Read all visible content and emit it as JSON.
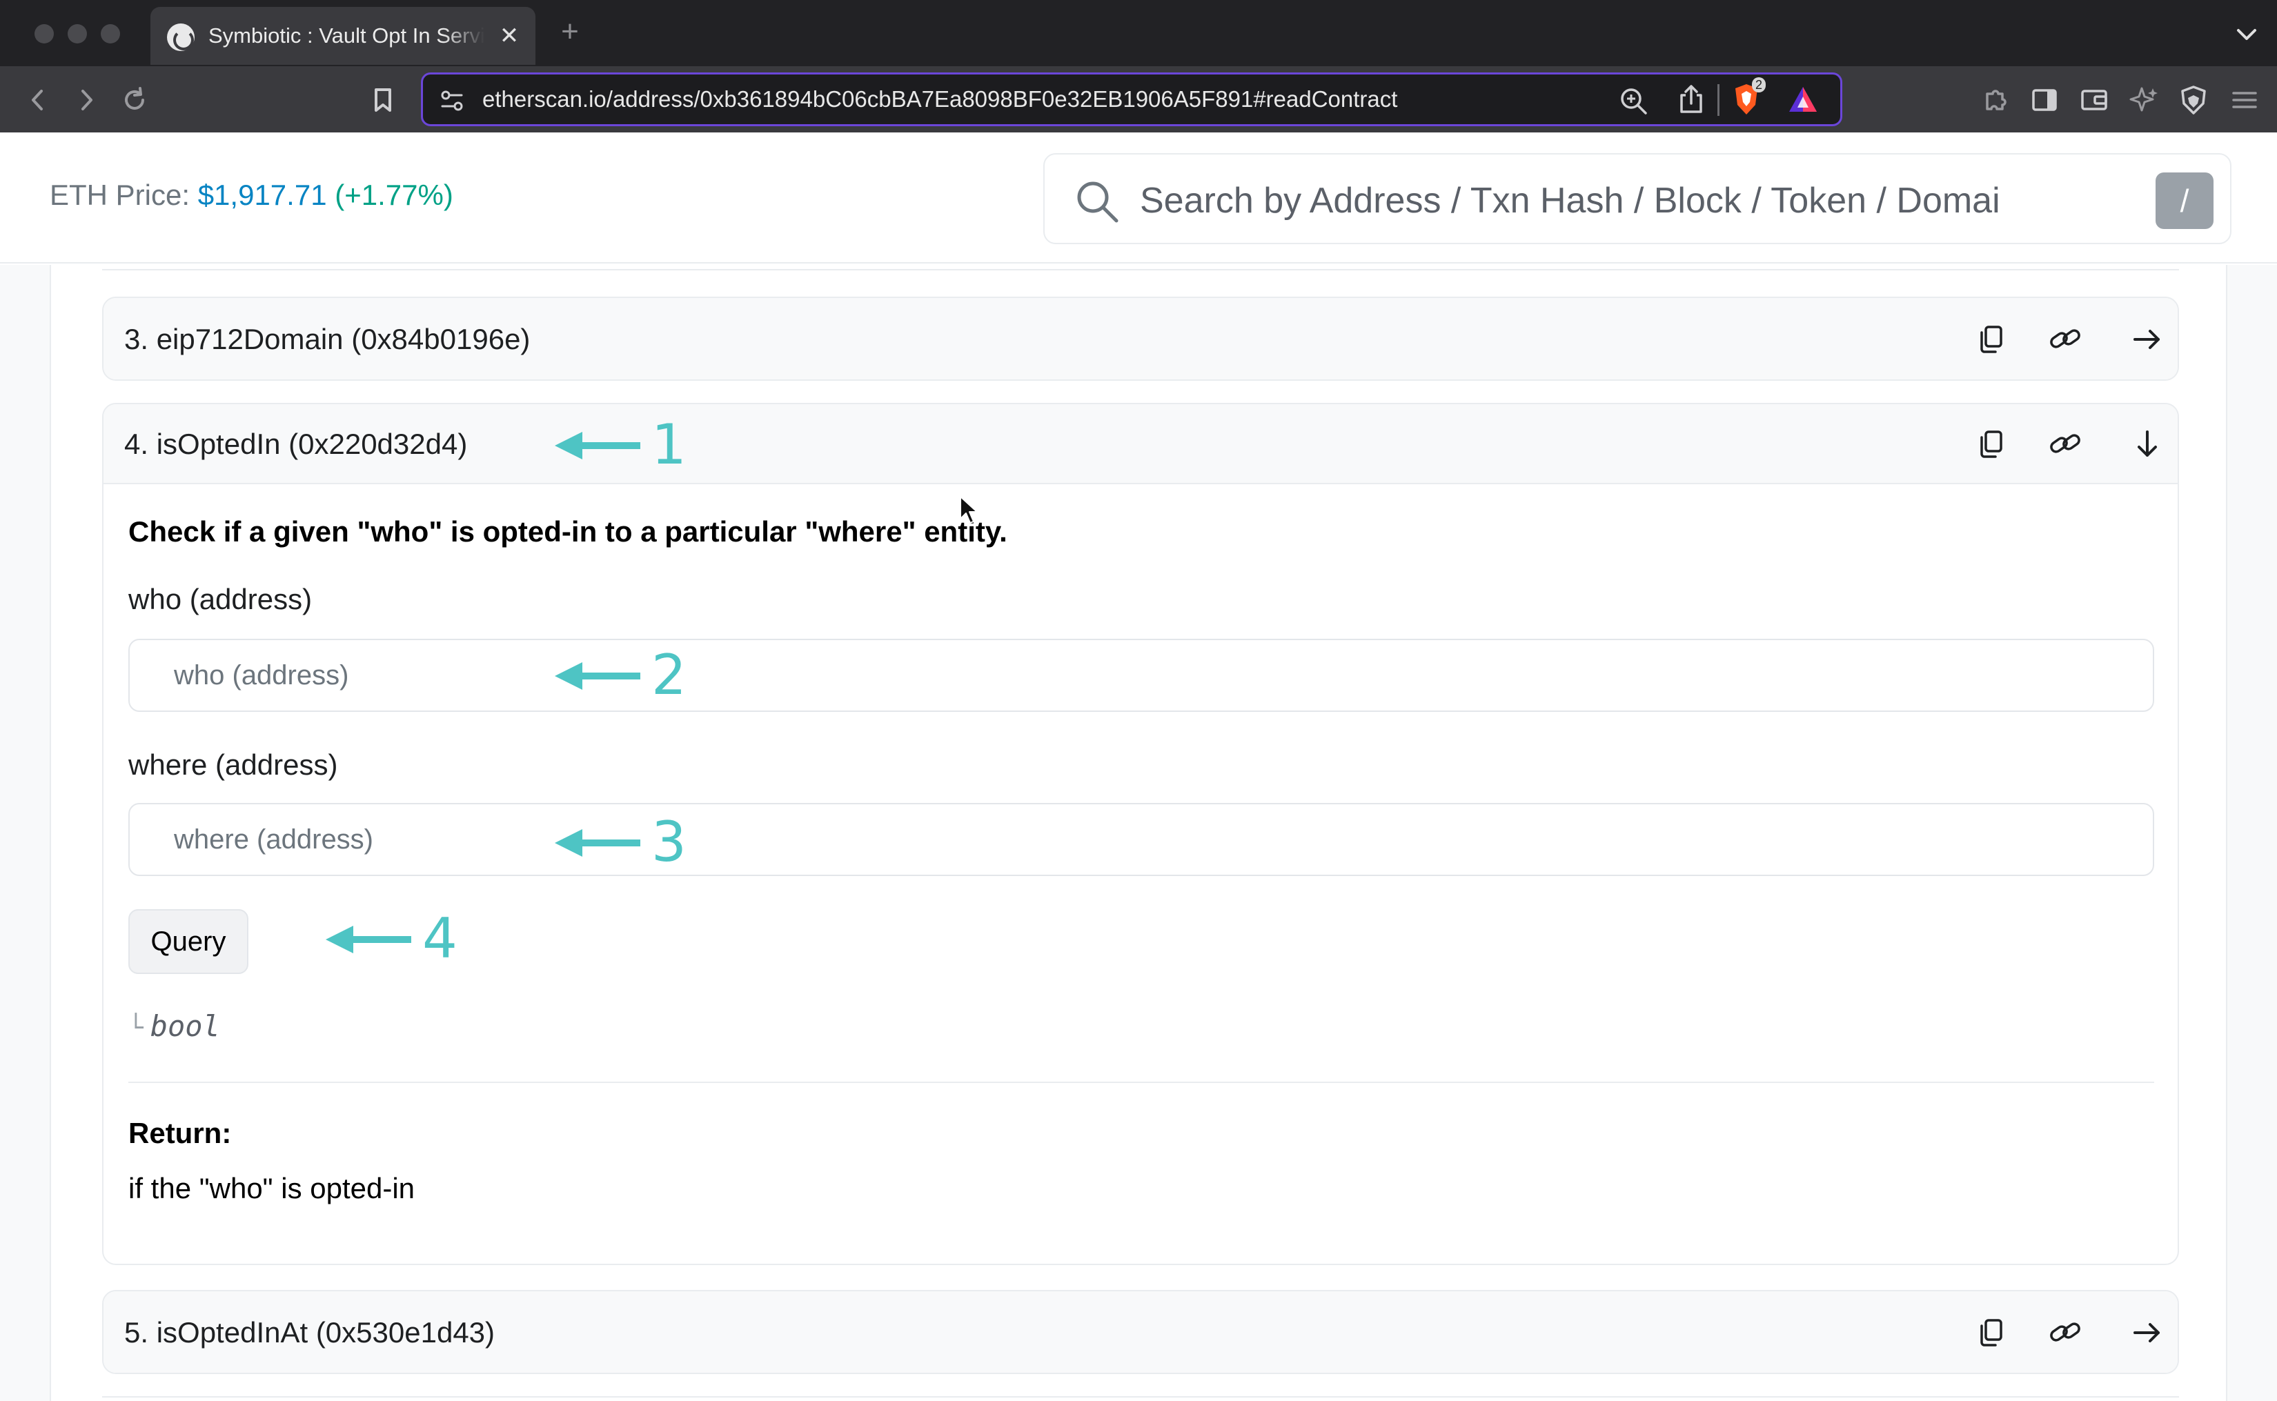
{
  "browser": {
    "tab_title": "Symbiotic : Vault Opt In Servi",
    "tab_close": "✕",
    "new_tab": "+",
    "url": "etherscan.io/address/0xb361894bC06cbBA7Ea8098BF0e32EB1906A5F891#readContract",
    "shields_count": "2"
  },
  "header": {
    "eth_price_label": "ETH Price:",
    "eth_price_value": "$1,917.71",
    "eth_price_change": "(+1.77%)",
    "search_placeholder": "Search by Address / Txn Hash / Block / Token / Domai",
    "search_shortcut": "/"
  },
  "functions": [
    {
      "title": "3. eip712Domain (0x84b0196e)"
    },
    {
      "title": "4. isOptedIn (0x220d32d4)",
      "description": "Check if a given \"who\" is opted-in to a particular \"where\" entity.",
      "inputs": [
        {
          "label": "who (address)",
          "placeholder": "who (address)"
        },
        {
          "label": "where (address)",
          "placeholder": "where (address)"
        }
      ],
      "query_label": "Query",
      "return_type": "bool",
      "return_heading": "Return:",
      "return_description": "if the \"who\" is opted-in"
    },
    {
      "title": "5. isOptedInAt (0x530e1d43)"
    }
  ],
  "annotations": [
    "1",
    "2",
    "3",
    "4"
  ],
  "colors": {
    "accent_link": "#0784c3",
    "price_change": "#00a186",
    "annotation": "#4ec4c4",
    "omnibox_focus": "#6b46d9"
  }
}
